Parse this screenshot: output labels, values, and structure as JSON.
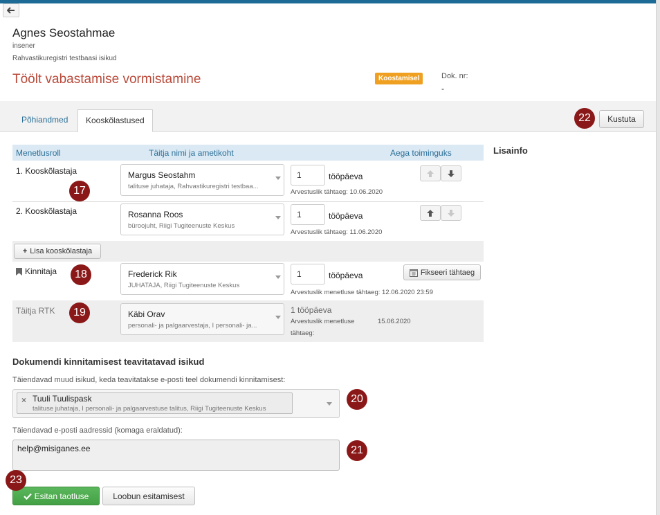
{
  "header": {
    "name": "Agnes Seostahmae",
    "role": "insener",
    "org": "Rahvastikuregistri testbaasi isikud",
    "doc_title": "Töölt vabastamise vormistamine",
    "status_badge": "Koostamisel",
    "dok_label": "Dok. nr:",
    "dok_value": "-"
  },
  "tabs": [
    {
      "label": "Põhiandmed",
      "active": false
    },
    {
      "label": "Kooskõlastused",
      "active": true
    }
  ],
  "toolbar": {
    "delete_label": "Kustuta"
  },
  "markers": {
    "m17": "17",
    "m18": "18",
    "m19": "19",
    "m20": "20",
    "m21": "21",
    "m22": "22",
    "m23": "23"
  },
  "table": {
    "headers": {
      "role": "Menetlusroll",
      "person": "Täitja nimi ja ametikoht",
      "time": "Aega toiminguks"
    },
    "rows": [
      {
        "role": "1. Kooskõlastaja",
        "name": "Margus Seostahm",
        "position": "talituse juhataja, Rahvastikuregistri testbaa...",
        "days": "1",
        "unit": "tööpäeva",
        "deadline": "Arvestuslik tähtaeg: 10.06.2020"
      },
      {
        "role": "2. Kooskõlastaja",
        "name": "Rosanna Roos",
        "position": "büroojuht, Riigi Tugiteenuste Keskus",
        "days": "1",
        "unit": "tööpäeva",
        "deadline": "Arvestuslik tähtaeg: 11.06.2020"
      },
      {
        "role": "Kinnitaja",
        "name": "Frederick Rik",
        "position": "JUHATAJA, Riigi Tugiteenuste Keskus",
        "days": "1",
        "unit": "tööpäeva",
        "deadline": "Arvestuslik menetluse tähtaeg: 12.06.2020 23:59",
        "fix_label": "Fikseeri tähtaeg"
      },
      {
        "role": "Täitja RTK",
        "name": "Käbi Orav",
        "position": "personali- ja palgaarvestaja, I personali- ja...",
        "days_text": "1 tööpäeva",
        "deadline_label1": "Arvestuslik menetluse",
        "deadline_label2": "tähtaeg:",
        "deadline_date": "15.06.2020"
      }
    ],
    "add_label": "Lisa kooskõlastaja"
  },
  "sidebar": {
    "title": "Lisainfo"
  },
  "notify": {
    "title": "Dokumendi kinnitamisest teavitatavad isikud",
    "persons_label": "Täiendavad muud isikud, keda teavitatakse e-posti teel dokumendi kinnitamisest:",
    "tag_name": "Tuuli Tuulispask",
    "tag_position": "talituse juhataja, I personali- ja palgaarvestuse talitus, Riigi Tugiteenuste Keskus",
    "emails_label": "Täiendavad e-posti aadressid (komaga eraldatud):",
    "emails_value": "help@misiganes.ee"
  },
  "actions": {
    "submit_label": "Esitan taotluse",
    "cancel_label": "Loobun esitamisest"
  }
}
